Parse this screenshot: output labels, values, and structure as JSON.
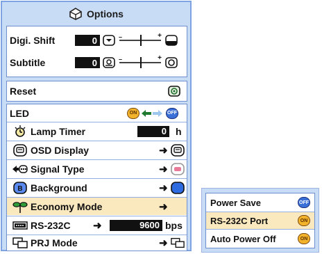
{
  "title": "Options",
  "digi_shift": {
    "label": "Digi. Shift",
    "value": "0"
  },
  "subtitle": {
    "label": "Subtitle",
    "value": "0"
  },
  "reset": {
    "label": "Reset"
  },
  "led": {
    "label": "LED",
    "on_label": "ON",
    "off_label": "OFF"
  },
  "lamp_timer": {
    "label": "Lamp Timer",
    "value": "0",
    "unit": "h"
  },
  "osd_display": {
    "label": "OSD Display"
  },
  "signal_type": {
    "label": "Signal Type"
  },
  "background": {
    "label": "Background"
  },
  "economy_mode": {
    "label": "Economy Mode"
  },
  "rs232c": {
    "label": "RS-232C",
    "value": "9600",
    "unit": "bps"
  },
  "prj_mode": {
    "label": "PRJ Mode"
  },
  "submenu": {
    "power_save": {
      "label": "Power Save",
      "state": "OFF"
    },
    "rs232c_port": {
      "label": "RS-232C Port",
      "state": "ON"
    },
    "auto_power_off": {
      "label": "Auto Power Off",
      "state": "ON"
    }
  },
  "colors": {
    "panel_bg": "#c9dcf6",
    "highlight": "#fae8bf",
    "on_badge": "#f2b22a",
    "off_badge": "#3a6fd8"
  }
}
